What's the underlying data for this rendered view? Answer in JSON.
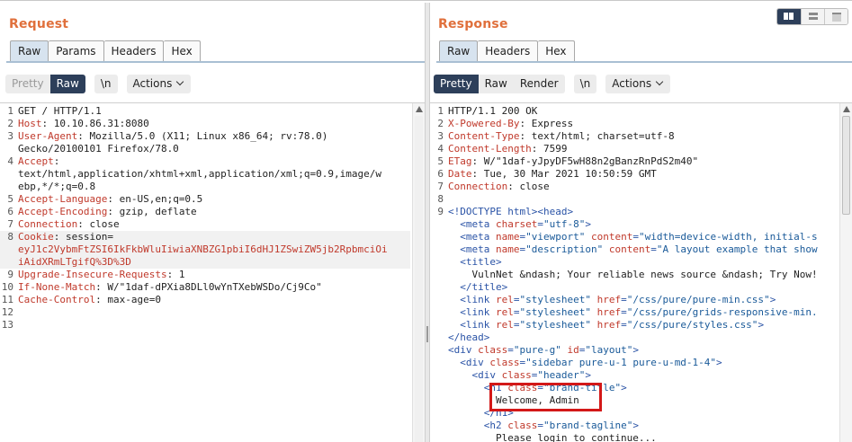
{
  "request": {
    "title": "Request",
    "tabs": [
      {
        "label": "Raw",
        "active": true
      },
      {
        "label": "Params",
        "active": false
      },
      {
        "label": "Headers",
        "active": false
      },
      {
        "label": "Hex",
        "active": false
      }
    ],
    "toolbar": {
      "view_modes": [
        {
          "label": "Pretty",
          "active": false
        },
        {
          "label": "Raw",
          "active": true
        }
      ],
      "newline_label": "\\n",
      "actions_label": "Actions"
    },
    "lines": [
      {
        "num": "1",
        "text": "GET / HTTP/1.1"
      },
      {
        "num": "2",
        "key": "Host",
        "text": ": 10.10.86.31:8080"
      },
      {
        "num": "3",
        "key": "User-Agent",
        "text": ": Mozilla/5.0 (X11; Linux x86_64; rv:78.0)"
      },
      {
        "num": "",
        "text": "Gecko/20100101 Firefox/78.0"
      },
      {
        "num": "4",
        "key": "Accept",
        "text": ":"
      },
      {
        "num": "",
        "text": "text/html,application/xhtml+xml,application/xml;q=0.9,image/w"
      },
      {
        "num": "",
        "text": "ebp,*/*;q=0.8"
      },
      {
        "num": "5",
        "key": "Accept-Language",
        "text": ": en-US,en;q=0.5"
      },
      {
        "num": "6",
        "key": "Accept-Encoding",
        "text": ": gzip, deflate"
      },
      {
        "num": "7",
        "key": "Connection",
        "text": ": close"
      },
      {
        "num": "8",
        "key": "Cookie",
        "text": ": session=",
        "hl": true
      },
      {
        "num": "",
        "cookie": "eyJ1c2VybmFtZSI6IkFkbWluIiwiaXNBZG1pbiI6dHJ1ZSwiZW5jb2RpbmciOi",
        "hl": true
      },
      {
        "num": "",
        "cookie": "iAidXRmLTgifQ%3D%3D",
        "hl": true
      },
      {
        "num": "9",
        "key": "Upgrade-Insecure-Requests",
        "text": ": 1"
      },
      {
        "num": "10",
        "key": "If-None-Match",
        "text": ": W/\"1daf-dPXia8DLl0wYnTXebWSDo/Cj9Co\""
      },
      {
        "num": "11",
        "key": "Cache-Control",
        "text": ": max-age=0"
      },
      {
        "num": "12",
        "text": ""
      },
      {
        "num": "13",
        "text": ""
      }
    ]
  },
  "response": {
    "title": "Response",
    "tabs": [
      {
        "label": "Raw",
        "active": true
      },
      {
        "label": "Headers",
        "active": false
      },
      {
        "label": "Hex",
        "active": false
      }
    ],
    "toolbar": {
      "view_modes": [
        {
          "label": "Pretty",
          "active": true
        },
        {
          "label": "Raw",
          "active": false
        },
        {
          "label": "Render",
          "active": false
        }
      ],
      "newline_label": "\\n",
      "actions_label": "Actions"
    },
    "lines": [
      {
        "num": "1",
        "text": "HTTP/1.1 200 OK"
      },
      {
        "num": "2",
        "key": "X-Powered-By",
        "text": ": Express"
      },
      {
        "num": "3",
        "key": "Content-Type",
        "text": ": text/html; charset=utf-8"
      },
      {
        "num": "4",
        "key": "Content-Length",
        "text": ": 7599"
      },
      {
        "num": "5",
        "key": "ETag",
        "text": ": W/\"1daf-yJpyDF5wH88n2gBanzRnPdS2m40\""
      },
      {
        "num": "6",
        "key": "Date",
        "text": ": Tue, 30 Mar 2021 10:50:59 GMT"
      },
      {
        "num": "7",
        "key": "Connection",
        "text": ": close"
      },
      {
        "num": "8",
        "text": ""
      },
      {
        "num": "9",
        "html": [
          [
            "tag",
            "<!DOCTYPE html><head>"
          ]
        ]
      },
      {
        "num": "",
        "html": [
          [
            "pad",
            "  "
          ],
          [
            "tag",
            "<meta "
          ],
          [
            "attr",
            "charset"
          ],
          [
            "tag",
            "="
          ],
          [
            "str",
            "\"utf-8\""
          ],
          [
            "tag",
            ">"
          ]
        ]
      },
      {
        "num": "",
        "html": [
          [
            "pad",
            "  "
          ],
          [
            "tag",
            "<meta "
          ],
          [
            "attr",
            "name"
          ],
          [
            "tag",
            "="
          ],
          [
            "str",
            "\"viewport\""
          ],
          [
            "tag",
            " "
          ],
          [
            "attr",
            "content"
          ],
          [
            "tag",
            "="
          ],
          [
            "str",
            "\"width=device-width, initial-s"
          ]
        ]
      },
      {
        "num": "",
        "html": [
          [
            "pad",
            "  "
          ],
          [
            "tag",
            "<meta "
          ],
          [
            "attr",
            "name"
          ],
          [
            "tag",
            "="
          ],
          [
            "str",
            "\"description\""
          ],
          [
            "tag",
            " "
          ],
          [
            "attr",
            "content"
          ],
          [
            "tag",
            "="
          ],
          [
            "str",
            "\"A layout example that show"
          ]
        ]
      },
      {
        "num": "",
        "html": [
          [
            "pad",
            "  "
          ],
          [
            "tag",
            "<title>"
          ]
        ]
      },
      {
        "num": "",
        "html": [
          [
            "pad",
            "    "
          ],
          [
            "text",
            "VulnNet &ndash; Your reliable news source &ndash; Try Now!"
          ]
        ]
      },
      {
        "num": "",
        "html": [
          [
            "pad",
            "  "
          ],
          [
            "tag",
            "</title>"
          ]
        ]
      },
      {
        "num": "",
        "html": [
          [
            "pad",
            "  "
          ],
          [
            "tag",
            "<link "
          ],
          [
            "attr",
            "rel"
          ],
          [
            "tag",
            "="
          ],
          [
            "str",
            "\"stylesheet\""
          ],
          [
            "tag",
            " "
          ],
          [
            "attr",
            "href"
          ],
          [
            "tag",
            "="
          ],
          [
            "str",
            "\"/css/pure/pure-min.css\""
          ],
          [
            "tag",
            ">"
          ]
        ]
      },
      {
        "num": "",
        "html": [
          [
            "pad",
            "  "
          ],
          [
            "tag",
            "<link "
          ],
          [
            "attr",
            "rel"
          ],
          [
            "tag",
            "="
          ],
          [
            "str",
            "\"stylesheet\""
          ],
          [
            "tag",
            " "
          ],
          [
            "attr",
            "href"
          ],
          [
            "tag",
            "="
          ],
          [
            "str",
            "\"/css/pure/grids-responsive-min."
          ]
        ]
      },
      {
        "num": "",
        "html": [
          [
            "pad",
            "  "
          ],
          [
            "tag",
            "<link "
          ],
          [
            "attr",
            "rel"
          ],
          [
            "tag",
            "="
          ],
          [
            "str",
            "\"stylesheet\""
          ],
          [
            "tag",
            " "
          ],
          [
            "attr",
            "href"
          ],
          [
            "tag",
            "="
          ],
          [
            "str",
            "\"/css/pure/styles.css\""
          ],
          [
            "tag",
            ">"
          ]
        ]
      },
      {
        "num": "",
        "html": [
          [
            "tag",
            "</head>"
          ]
        ]
      },
      {
        "num": "",
        "html": [
          [
            "tag",
            "<div "
          ],
          [
            "attr",
            "class"
          ],
          [
            "tag",
            "="
          ],
          [
            "str",
            "\"pure-g\""
          ],
          [
            "tag",
            " "
          ],
          [
            "attr",
            "id"
          ],
          [
            "tag",
            "="
          ],
          [
            "str",
            "\"layout\""
          ],
          [
            "tag",
            ">"
          ]
        ]
      },
      {
        "num": "",
        "html": [
          [
            "pad",
            "  "
          ],
          [
            "tag",
            "<div "
          ],
          [
            "attr",
            "class"
          ],
          [
            "tag",
            "="
          ],
          [
            "str",
            "\"sidebar pure-u-1 pure-u-md-1-4\""
          ],
          [
            "tag",
            ">"
          ]
        ]
      },
      {
        "num": "",
        "html": [
          [
            "pad",
            "    "
          ],
          [
            "tag",
            "<div "
          ],
          [
            "attr",
            "class"
          ],
          [
            "tag",
            "="
          ],
          [
            "str",
            "\"header\""
          ],
          [
            "tag",
            ">"
          ]
        ]
      },
      {
        "num": "",
        "html": [
          [
            "pad",
            "      "
          ],
          [
            "tag",
            "<h1 "
          ],
          [
            "attr",
            "class"
          ],
          [
            "tag",
            "="
          ],
          [
            "str",
            "\"brand-title\""
          ],
          [
            "tag",
            ">"
          ]
        ]
      },
      {
        "num": "",
        "html": [
          [
            "pad",
            "        "
          ],
          [
            "text",
            "Welcome, Admin"
          ]
        ]
      },
      {
        "num": "",
        "html": [
          [
            "pad",
            "      "
          ],
          [
            "tag",
            "</h1>"
          ]
        ]
      },
      {
        "num": "",
        "html": [
          [
            "pad",
            "      "
          ],
          [
            "tag",
            "<h2 "
          ],
          [
            "attr",
            "class"
          ],
          [
            "tag",
            "="
          ],
          [
            "str",
            "\"brand-tagline\""
          ],
          [
            "tag",
            ">"
          ]
        ]
      },
      {
        "num": "",
        "html": [
          [
            "pad",
            "        "
          ],
          [
            "text",
            "Please login to continue..."
          ]
        ]
      }
    ]
  }
}
